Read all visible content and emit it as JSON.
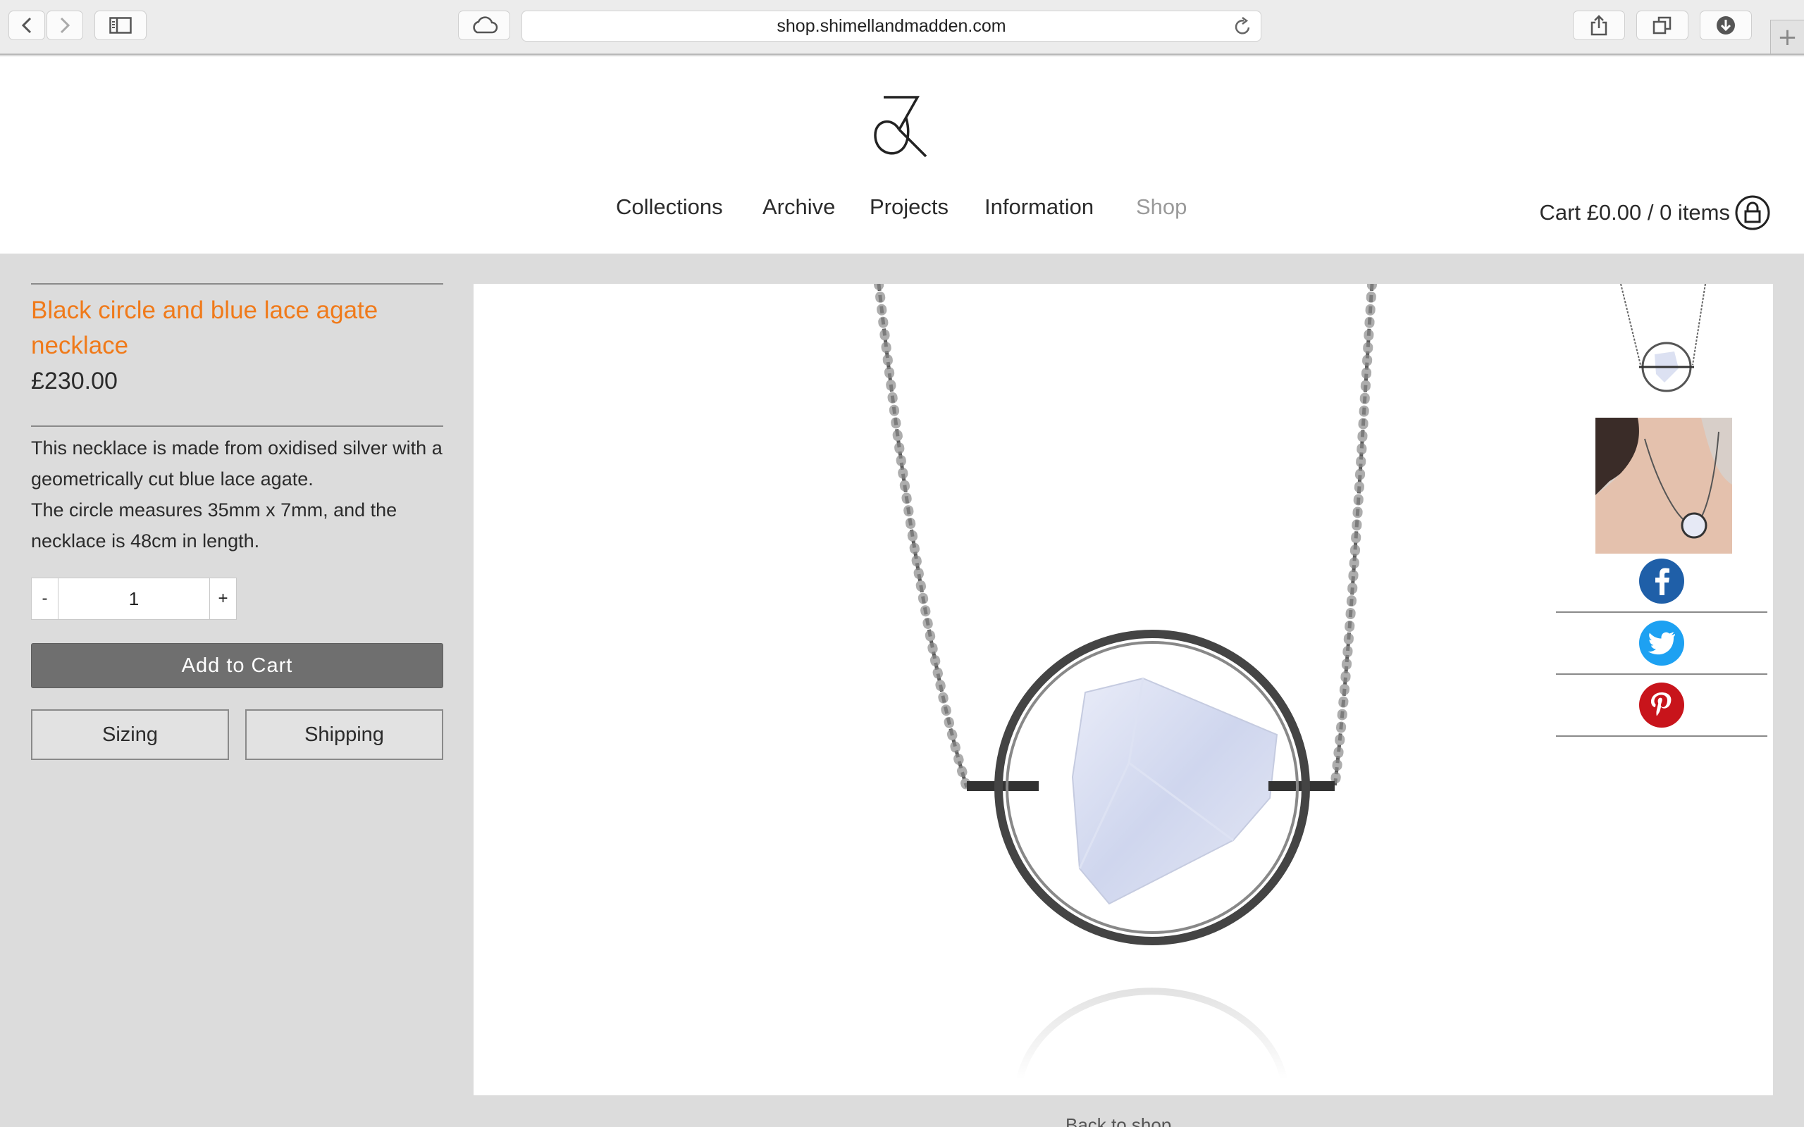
{
  "browser": {
    "url": "shop.shimellandmadden.com",
    "new_tab_glyph": "+"
  },
  "nav": {
    "items": [
      {
        "label": "Collections"
      },
      {
        "label": "Archive"
      },
      {
        "label": "Projects"
      },
      {
        "label": "Information"
      },
      {
        "label": "Shop"
      }
    ],
    "cart_label": "Cart £0.00 / 0 items"
  },
  "product": {
    "title": "Black circle and blue lace agate necklace",
    "price": "£230.00",
    "description": [
      "This necklace is made from oxidised silver with a geometrically cut blue lace agate.",
      "The circle measures 35mm x 7mm, and the necklace is 48cm in length."
    ],
    "qty_minus": "-",
    "qty_value": "1",
    "qty_plus": "+",
    "add_to_cart": "Add to Cart",
    "sizing": "Sizing",
    "shipping": "Shipping"
  },
  "social": {
    "facebook_color": "#1f5fa8",
    "twitter_color": "#1da1f2",
    "pinterest_color": "#c8141b"
  },
  "footer": {
    "partial_text": "Back to shop"
  },
  "icons": [
    "chevron-left-icon",
    "chevron-right-icon",
    "sidebar-icon",
    "cloud-icon",
    "reload-icon",
    "share-icon",
    "tabs-icon",
    "download-icon",
    "lock-icon",
    "facebook-icon",
    "twitter-icon",
    "pinterest-icon"
  ]
}
